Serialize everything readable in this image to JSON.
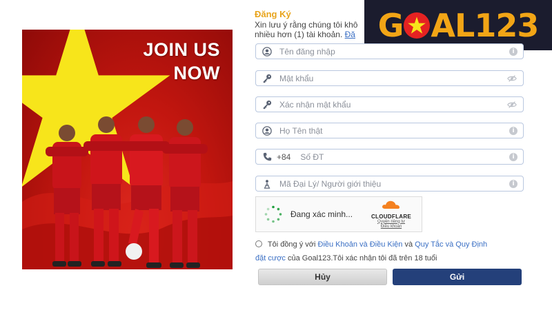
{
  "banner": {
    "line1": "JOIN US",
    "line2": "NOW"
  },
  "logo": {
    "part1": "G",
    "part2": "AL123"
  },
  "header": {
    "title": "Đăng Ký",
    "note_line1": "Xin lưu ý rằng chúng tôi khô",
    "note_line2": "nhiều hơn (1) tài khoản.",
    "note_link": "Đă"
  },
  "form": {
    "username_placeholder": "Tên đăng nhập",
    "password_placeholder": "Mật khẩu",
    "confirm_password_placeholder": "Xác nhận mật khẩu",
    "fullname_placeholder": "Họ Tên thật",
    "phone_prefix": "+84",
    "phone_placeholder": "Số ĐT",
    "referral_placeholder": "Mã Đại Lý/ Người giới thiệu",
    "info_glyph": "i"
  },
  "captcha": {
    "status": "Đang xác minh...",
    "brand": "CLOUDFLARE",
    "privacy": "Quyền riêng tư",
    "terms": "Điều khoản"
  },
  "agreement": {
    "prefix": "Tôi đồng ý với",
    "terms_link": "Điều Khoản và Điều Kiện",
    "and": "và",
    "rules_link": "Quy Tắc và Quy Định đặt cược",
    "suffix": "của Goal123.Tôi xác nhận tôi đã trên 18 tuổi"
  },
  "buttons": {
    "cancel": "Hủy",
    "send": "Gửi"
  },
  "colors": {
    "accent": "#e8a41c",
    "primary_button": "#24407a",
    "link": "#3a6fc4",
    "banner_red": "#c2160f",
    "star_yellow": "#f7e51b"
  },
  "icons": [
    "user-icon",
    "key-icon",
    "eye-off-icon",
    "info-icon",
    "phone-icon",
    "referral-icon",
    "spinner-icon",
    "cloudflare-icon"
  ]
}
